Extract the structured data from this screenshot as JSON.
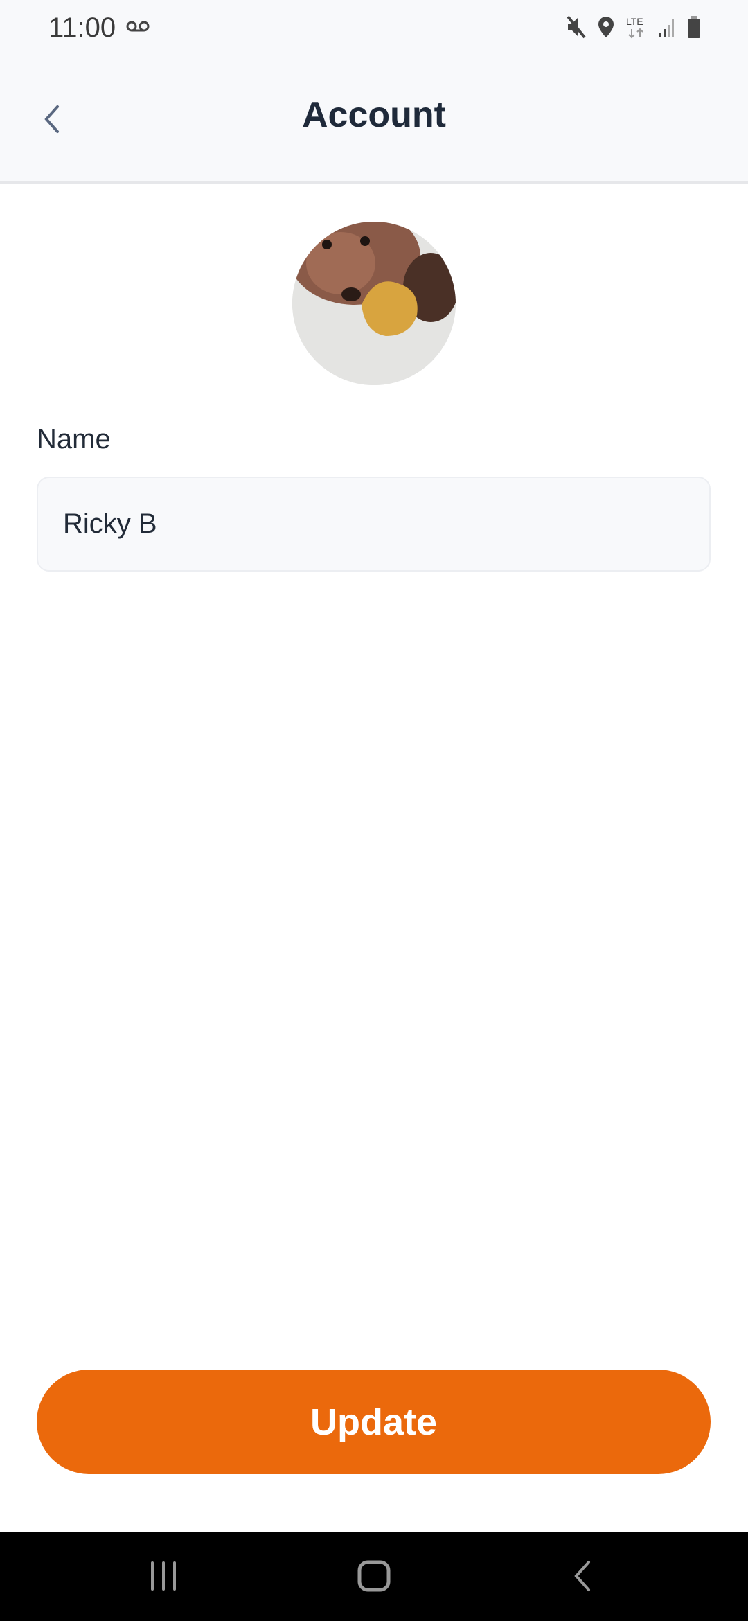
{
  "status_bar": {
    "time": "11:00",
    "icons": [
      "voicemail-icon",
      "mute-icon",
      "location-icon",
      "lte-icon",
      "signal-icon",
      "battery-icon"
    ],
    "network": "LTE"
  },
  "header": {
    "title": "Account",
    "back_icon": "chevron-left-icon"
  },
  "profile": {
    "avatar": "dog-photo"
  },
  "form": {
    "name_label": "Name",
    "name_value": "Ricky B"
  },
  "actions": {
    "update_label": "Update"
  },
  "colors": {
    "accent": "#eb690c",
    "text": "#1f2a3a"
  },
  "nav_bar": {
    "icons": [
      "recent-apps-icon",
      "home-icon",
      "back-icon"
    ]
  }
}
